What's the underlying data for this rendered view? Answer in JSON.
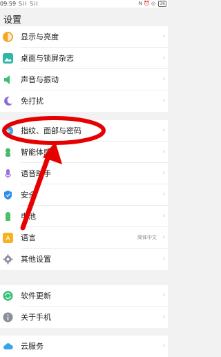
{
  "status_bar": {
    "time": "09:59",
    "signal_text": "Sil Sil",
    "right_text": "N ⏰ ◎",
    "battery": "36"
  },
  "page": {
    "title": "设置"
  },
  "groups": [
    {
      "items": [
        {
          "label": "显示与亮度",
          "icon": "display-brightness-icon",
          "color": "#f5a623"
        },
        {
          "label": "桌面与锁屏杂志",
          "icon": "wallpaper-icon",
          "color": "#2fb6a8"
        },
        {
          "label": "声音与振动",
          "icon": "sound-icon",
          "color": "#38c172"
        },
        {
          "label": "免打扰",
          "icon": "moon-icon",
          "color": "#8e6bd8"
        }
      ]
    },
    {
      "items": [
        {
          "label": "指纹、面部与密码",
          "icon": "fingerprint-icon",
          "color": "#3aa6e0"
        },
        {
          "label": "智能体感",
          "icon": "smart-motion-icon",
          "color": "#4cb86a"
        },
        {
          "label": "语音助手",
          "icon": "microphone-icon",
          "color": "#9b6fe0"
        },
        {
          "label": "安全",
          "icon": "shield-icon",
          "color": "#2f8fea"
        },
        {
          "label": "电池",
          "icon": "battery-icon",
          "color": "#49c06a"
        },
        {
          "label": "语言",
          "icon": "language-icon",
          "color": "#f5b21e",
          "value": "简体中文"
        },
        {
          "label": "其他设置",
          "icon": "gear-icon",
          "color": "#8a8f99"
        }
      ]
    },
    {
      "items": [
        {
          "label": "软件更新",
          "icon": "update-icon",
          "color": "#36c07a"
        },
        {
          "label": "关于手机",
          "icon": "info-icon",
          "color": "#8a8f99"
        }
      ]
    },
    {
      "items": [
        {
          "label": "云服务",
          "icon": "cloud-icon",
          "color": "#37a3e8"
        }
      ]
    }
  ]
}
